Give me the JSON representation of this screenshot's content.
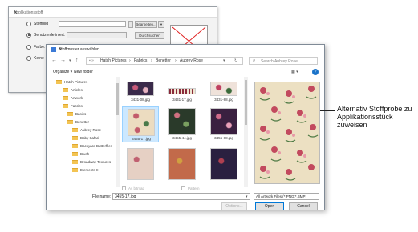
{
  "applikation_dialog": {
    "title": "Applikationsstoff",
    "close_glyph": "×",
    "options": [
      {
        "label": "Stoffbild",
        "selected": false
      },
      {
        "label": "Benutzerdefiniert:",
        "selected": true
      },
      {
        "label": "Farbe:",
        "selected": false
      },
      {
        "label": "Keine",
        "selected": false
      }
    ],
    "browse_label": "Bearbeiten...",
    "search_label": "Durchsuchen"
  },
  "file_dialog": {
    "title": "Stoffmuster auswählen",
    "close_glyph": "×",
    "breadcrumb": [
      "Hatch Pictures",
      "Fabrics",
      "Benetter",
      "Aubrey Rose"
    ],
    "search_placeholder": "Search Aubrey Rose",
    "organize_label": "Organize ▾",
    "new_folder_label": "New folder",
    "folders": [
      "Hatch Pictures",
      "Articles",
      "Artwork",
      "Fabrics",
      "Basics",
      "Benetter",
      "Aubrey Rose",
      "Baby Safari",
      "Backyard Butterflies",
      "Blush",
      "Broadway Textures",
      "Elements II"
    ],
    "files": [
      {
        "name": "3431-08.jpg",
        "selected": false
      },
      {
        "name": "3431-17.jpg",
        "selected": false
      },
      {
        "name": "3431-88.jpg",
        "selected": false
      },
      {
        "name": "3455-17.jpg",
        "selected": true
      },
      {
        "name": "3455-44.jpg",
        "selected": false
      },
      {
        "name": "3455-88.jpg",
        "selected": false
      },
      {
        "name": "",
        "selected": false
      },
      {
        "name": "",
        "selected": false
      },
      {
        "name": "",
        "selected": false
      }
    ],
    "as_bitmap_label": "As bitmap",
    "pattern_label": "Pattern",
    "file_name_label": "File name:",
    "file_name_value": "3455-17.jpg",
    "file_type_value": "All Artwork Files (*.PNG;*.BMP;",
    "options_label": "Options...",
    "open_label": "Open",
    "cancel_label": "Cancel"
  },
  "callout_text": "Alternativ Stoffprobe zu Applikationsstück zuweisen",
  "colors": {
    "accent": "#0078d7",
    "folder": "#f3c453",
    "selection": "#cce8ff"
  }
}
